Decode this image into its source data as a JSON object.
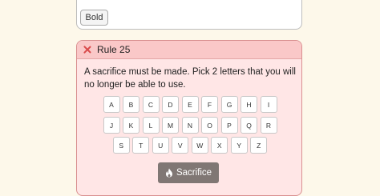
{
  "top_card": {
    "bold_label": "Bold"
  },
  "rule": {
    "title": "Rule 25",
    "text": "A sacrifice must be made. Pick 2 letters that you will no longer be able to use.",
    "keyboard_rows": [
      [
        "A",
        "B",
        "C",
        "D",
        "E",
        "F",
        "G",
        "H",
        "I"
      ],
      [
        "J",
        "K",
        "L",
        "M",
        "N",
        "O",
        "P",
        "Q",
        "R"
      ],
      [
        "S",
        "T",
        "U",
        "V",
        "W",
        "X",
        "Y",
        "Z"
      ]
    ],
    "button_label": "Sacrifice",
    "button_icon": "flame-icon"
  },
  "colors": {
    "page_bg": "#fdf8ea",
    "rule_bg": "#ffe6e6",
    "rule_header_bg": "#fac8c8",
    "close_icon": "#d94a4a",
    "button_bg": "#807774"
  }
}
